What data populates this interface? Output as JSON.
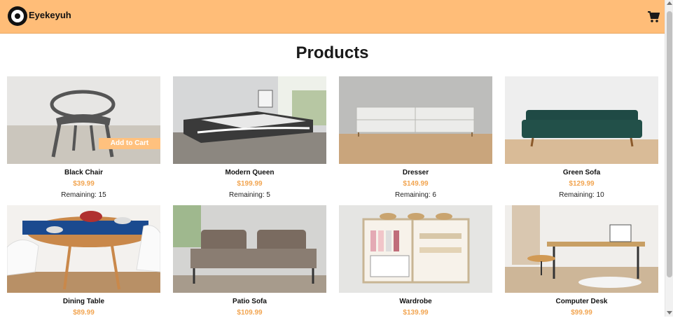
{
  "header": {
    "brand": "Eyekeyuh",
    "cart_icon": "shopping-cart-icon",
    "background_color": "#ffbd78"
  },
  "page": {
    "title": "Products",
    "accent_color": "#f2a551"
  },
  "products": [
    {
      "name": "Black Chair",
      "price": "$39.99",
      "remaining": "Remaining: 15",
      "action": "Add to Cart"
    },
    {
      "name": "Modern Queen",
      "price": "$199.99",
      "remaining": "Remaining: 5"
    },
    {
      "name": "Dresser",
      "price": "$149.99",
      "remaining": "Remaining: 6"
    },
    {
      "name": "Green Sofa",
      "price": "$129.99",
      "remaining": "Remaining: 10"
    },
    {
      "name": "Dining Table",
      "price": "$89.99"
    },
    {
      "name": "Patio Sofa",
      "price": "$109.99"
    },
    {
      "name": "Wardrobe",
      "price": "$139.99"
    },
    {
      "name": "Computer Desk",
      "price": "$99.99"
    }
  ]
}
